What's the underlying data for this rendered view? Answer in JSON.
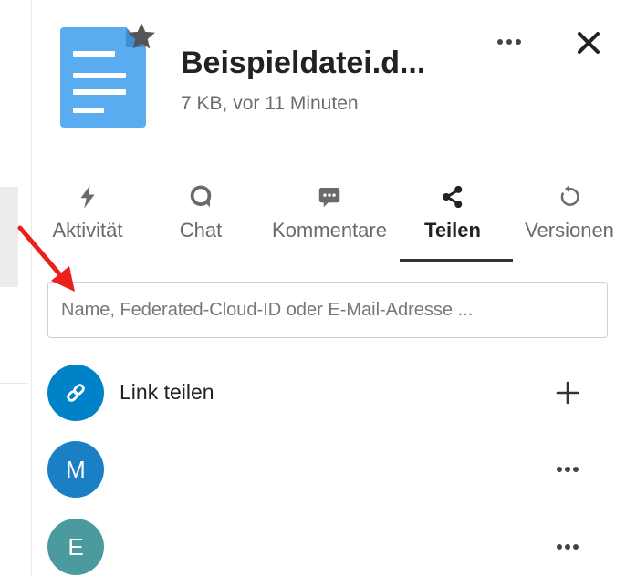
{
  "header": {
    "file_name": "Beispieldatei.d...",
    "file_meta": "7 KB, vor 11 Minuten",
    "icons": {
      "file": "document-icon",
      "favorite": "star-icon",
      "more": "more-horizontal-icon",
      "close": "close-icon"
    }
  },
  "tabs": [
    {
      "label": "Aktivität",
      "icon": "lightning-icon",
      "active": false
    },
    {
      "label": "Chat",
      "icon": "chat-bubble-icon",
      "active": false
    },
    {
      "label": "Kommentare",
      "icon": "comment-icon",
      "active": false
    },
    {
      "label": "Teilen",
      "icon": "share-icon",
      "active": true
    },
    {
      "label": "Versionen",
      "icon": "history-icon",
      "active": false
    }
  ],
  "share": {
    "search_placeholder": "Name, Federated-Cloud-ID oder E-Mail-Adresse ..."
  },
  "share_rows": [
    {
      "avatar_text": "",
      "label": "Link teilen",
      "avatar_icon": "link-icon",
      "action_icon": "plus-icon",
      "avatar_color": "#0082c9"
    },
    {
      "avatar_text": "M",
      "label": "",
      "action_icon": "more-horizontal-icon",
      "avatar_color": "#1a7fc4"
    },
    {
      "avatar_text": "E",
      "label": "",
      "action_icon": "more-horizontal-icon",
      "avatar_color": "#4a9a9e"
    }
  ],
  "colors": {
    "file_icon": "#5aacf0",
    "primary": "#0082c9",
    "annotation": "#e8221b",
    "active_tab": "#222222"
  }
}
